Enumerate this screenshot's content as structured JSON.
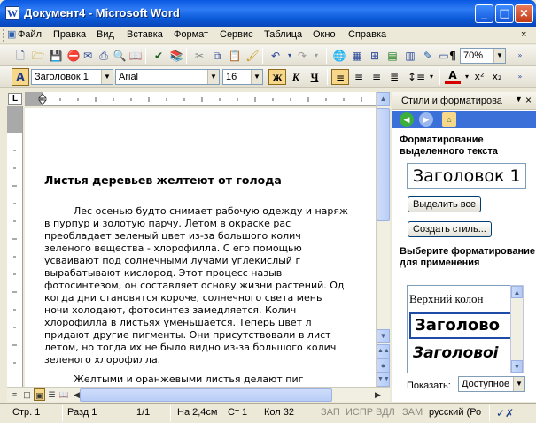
{
  "window": {
    "title": "Документ4 - Microsoft Word",
    "app_icon": "W"
  },
  "menu": [
    "Файл",
    "Правка",
    "Вид",
    "Вставка",
    "Формат",
    "Сервис",
    "Таблица",
    "Окно",
    "Справка"
  ],
  "toolbar": {
    "zoom": "70%",
    "style": "Заголовок 1",
    "font": "Arial",
    "size": "16",
    "bold": "Ж",
    "italic": "К",
    "underline": "Ч"
  },
  "document": {
    "title": "Листья деревьев желтеют от голода",
    "lines": [
      "Лес осенью будто снимает рабочую одежду и наряж",
      "в пурпур и золотую парчу. Летом в окраске рас",
      "преобладает  зеленый  цвет  из-за  большого  колич",
      "зеленого вещества - хлорофилла. С его помощью",
      "усваивают  под  солнечными  лучами  углекислый  г",
      "вырабатывают   кислород.   Этот   процесс   назыв",
      "фотосинтезом, он составляет основу жизни растений. Од",
      "когда дни становятся короче, солнечного света мень",
      "ночи   холодают,   фотосинтез   замедляется.   Колич",
      "хлорофилла в листьях уменьшается. Теперь цвет л",
      "придают другие пигменты. Они присутствовали в лист",
      "летом, но тогда их не было видно из-за большого колич",
      "зеленого хлорофилла.",
      "Желтыми   и   оранжевыми   листья   делают   пиг"
    ]
  },
  "pane": {
    "title": "Стили и форматирова",
    "selected_heading": "Форматирование выделенного текста",
    "selected_style": "Заголовок 1",
    "select_all": "Выделить все",
    "create_style": "Создать стиль...",
    "choose_heading": "Выберите форматирование для применения",
    "styles": [
      "Верхний колон",
      "Заголово",
      "Заголовоі"
    ],
    "para_mark": "¶",
    "show_label": "Показать:",
    "show_value": "Доступное"
  },
  "status": {
    "page": "Стр. 1",
    "section": "Разд 1",
    "pages": "1/1",
    "at": "На 2,4см",
    "line": "Ст 1",
    "col": "Кол 32",
    "rec": "ЗАП",
    "trk": "ИСПР",
    "ext": "ВДЛ",
    "ovr": "ЗАМ",
    "lang": "русский (Ро"
  },
  "icons": [
    "new-icon",
    "open-icon",
    "save-icon",
    "permission-icon",
    "email-icon",
    "print-icon",
    "print-preview-icon",
    "spelling-icon",
    "research-icon",
    "cut-icon",
    "copy-icon",
    "paste-icon",
    "format-painter-icon",
    "undo-icon",
    "redo-icon",
    "hyperlink-icon",
    "tables-borders-icon",
    "insert-table-icon",
    "insert-excel-icon",
    "columns-icon",
    "drawing-icon",
    "document-map-icon",
    "show-hide-icon",
    "help-icon"
  ],
  "colors": {
    "title_bar": "#0a58e0",
    "accent": "#3a70d8",
    "font_color_bar": "#d40000",
    "highlight": "#f7d78a"
  }
}
